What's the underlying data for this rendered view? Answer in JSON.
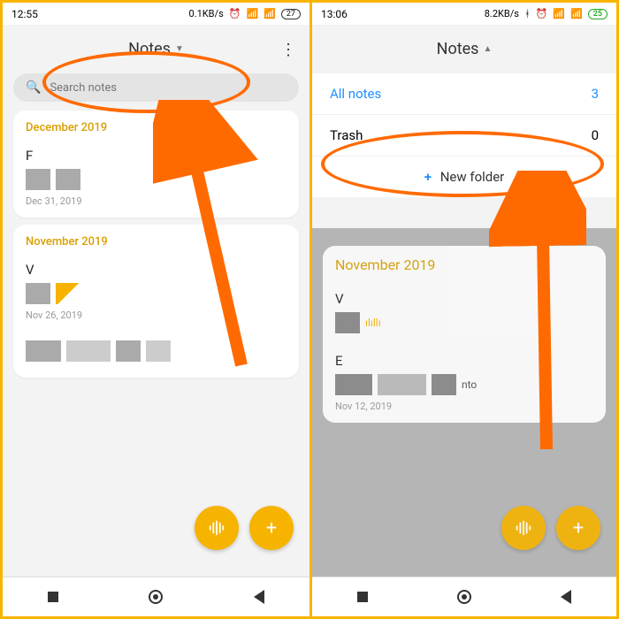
{
  "left": {
    "time": "12:55",
    "net": "0.1KB/s",
    "battery": "27",
    "title": "Notes",
    "search_placeholder": "Search notes",
    "sections": [
      {
        "month": "December 2019",
        "notes": [
          {
            "title": "F",
            "date": "Dec 31, 2019"
          }
        ]
      },
      {
        "month": "November 2019",
        "notes": [
          {
            "title": "V",
            "date": "Nov 26, 2019"
          },
          {
            "title": "",
            "date": ""
          }
        ]
      }
    ]
  },
  "right": {
    "time": "13:06",
    "net": "8.2KB/s",
    "battery": "25",
    "title": "Notes",
    "folders": [
      {
        "name": "All notes",
        "count": "3",
        "active": true
      },
      {
        "name": "Trash",
        "count": "0",
        "active": false
      }
    ],
    "new_folder": "New folder",
    "section_month": "November 2019",
    "preview_date": "Nov 12, 2019"
  }
}
